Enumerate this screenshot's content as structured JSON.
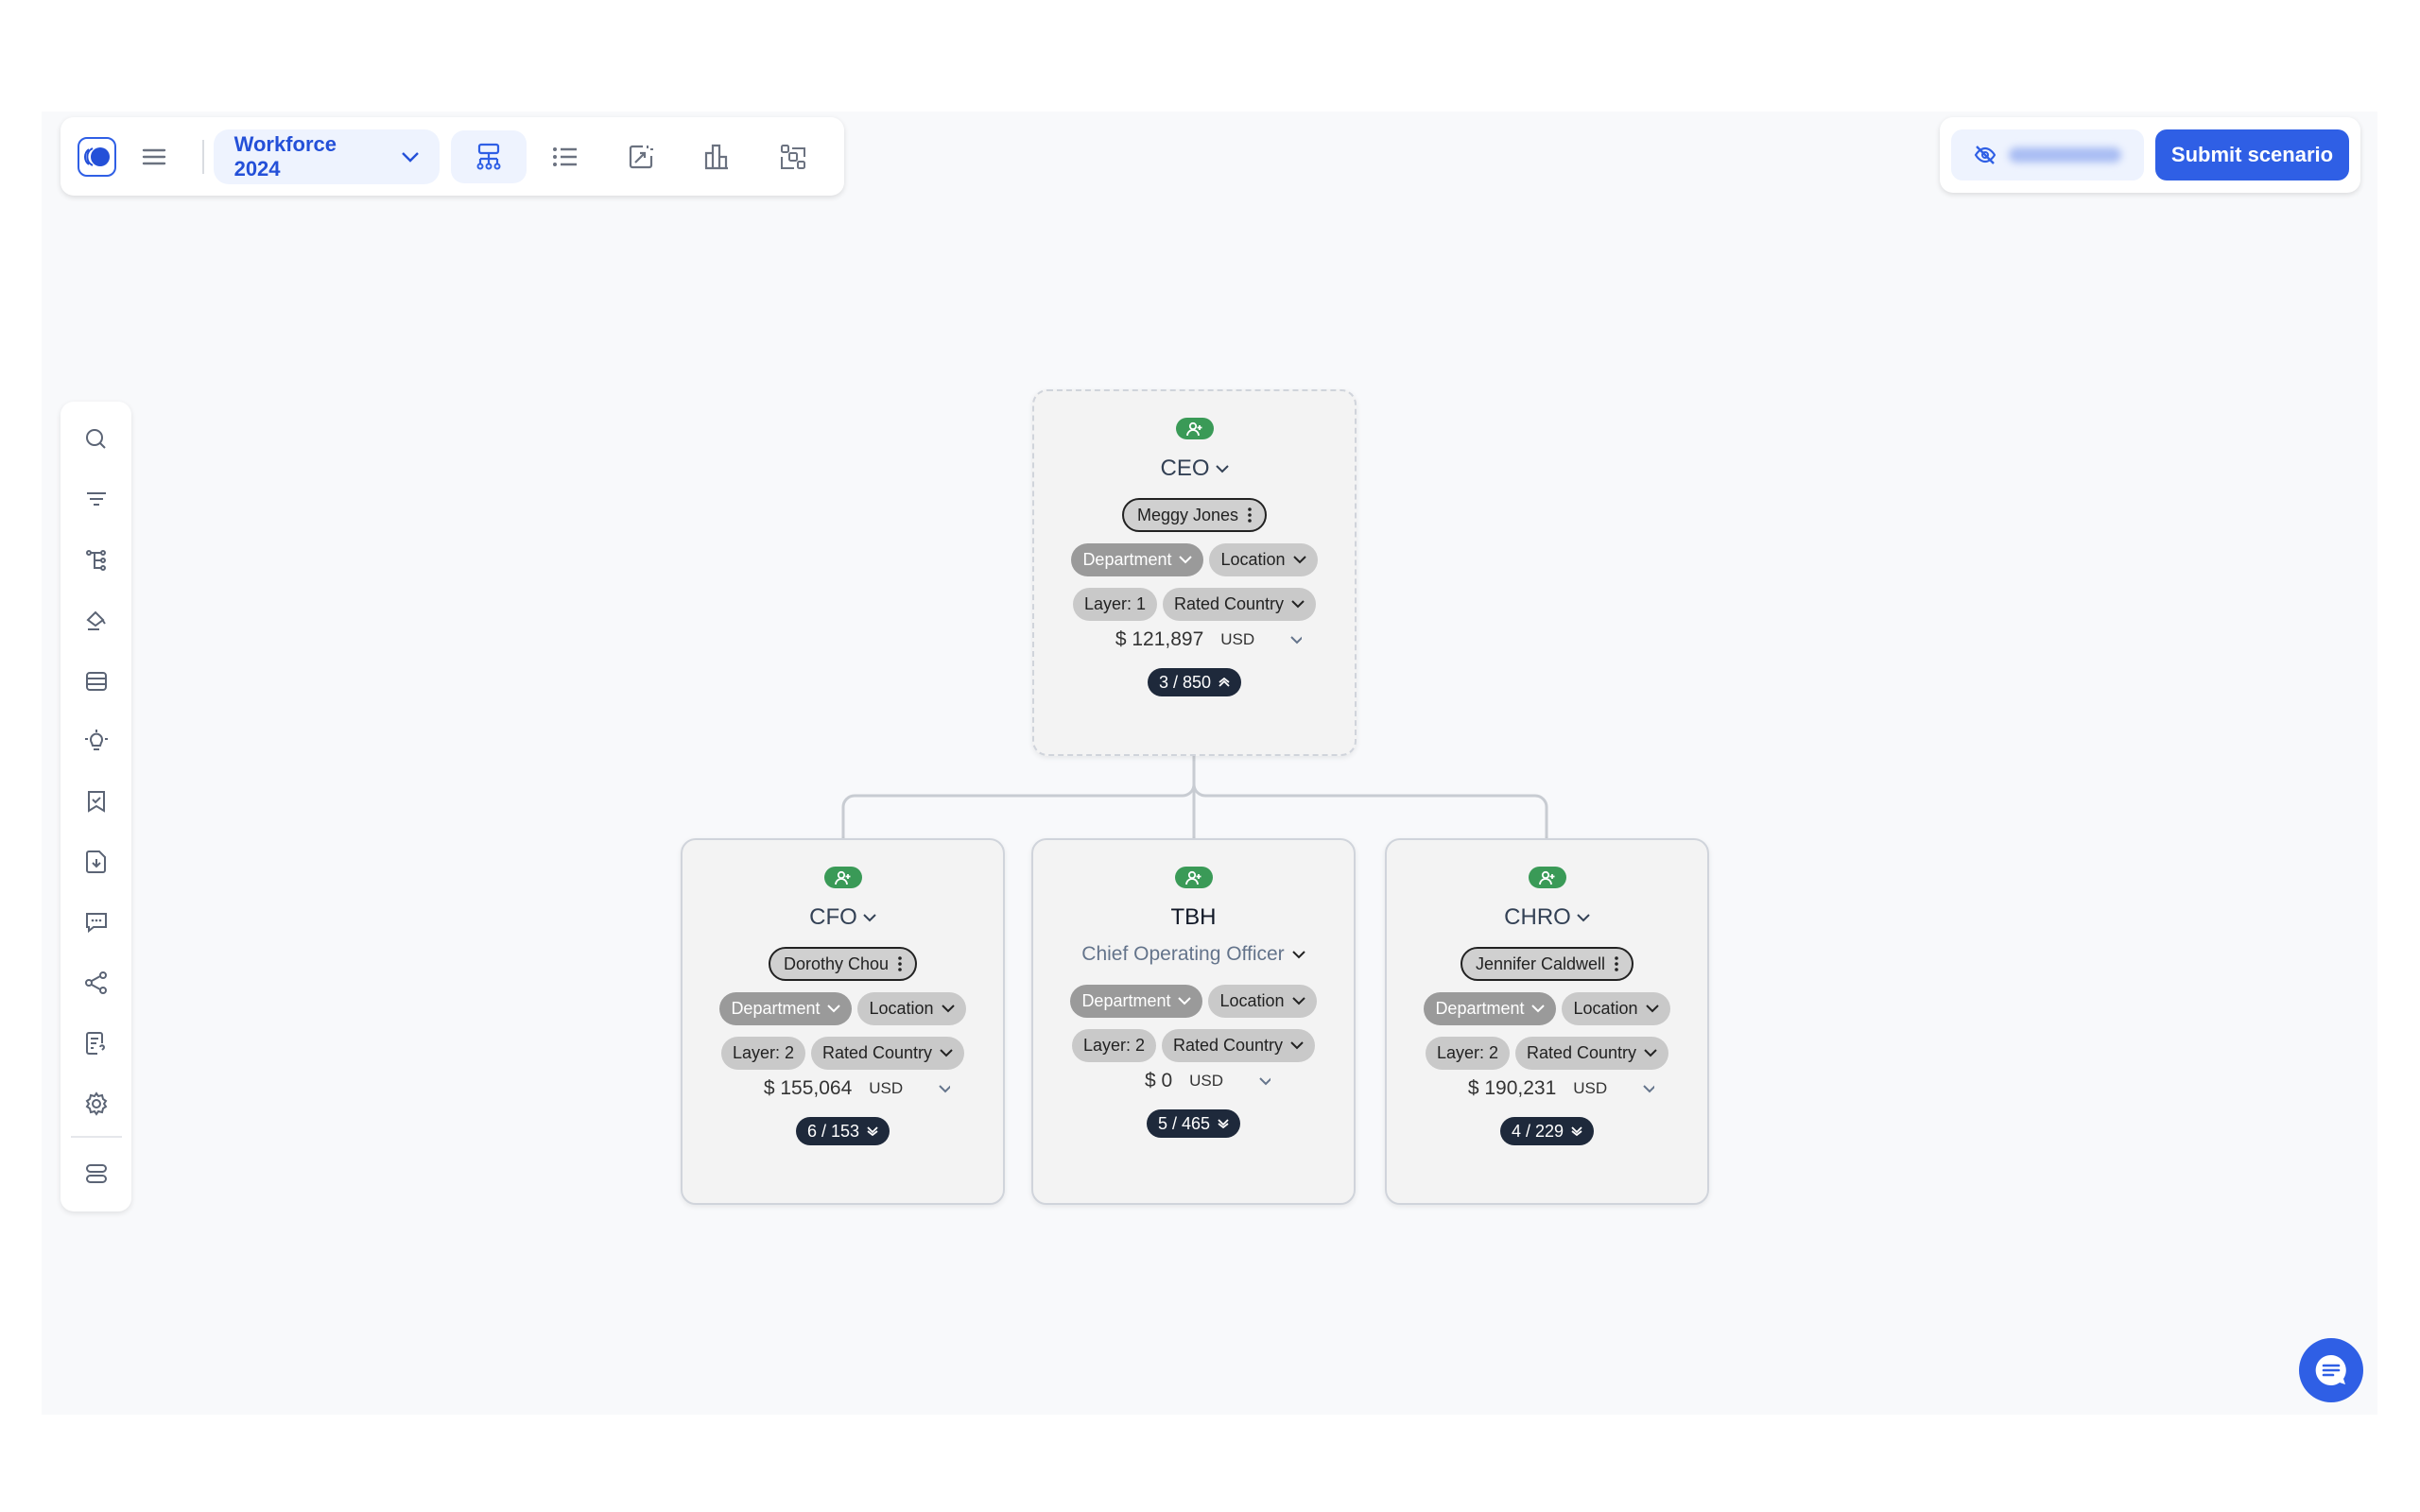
{
  "toolbar": {
    "scenario": "Workforce 2024",
    "icons": [
      "app-logo",
      "menu-icon",
      "org-chart-icon",
      "list-icon",
      "export-chart-icon",
      "bar-chart-icon",
      "compare-icon"
    ]
  },
  "actions": {
    "visibility_icon": "eye-off-icon",
    "submit_label": "Submit scenario"
  },
  "sidebar": {
    "items": [
      "search-icon",
      "filter-icon",
      "hierarchy-icon",
      "paint-bucket-icon",
      "table-icon",
      "lightbulb-icon",
      "bookmark-check-icon",
      "file-download-icon",
      "comment-icon",
      "share-icon",
      "file-question-icon",
      "settings-icon",
      "layers-icon"
    ]
  },
  "colors": {
    "accent": "#2f5fe5",
    "add_badge": "#3a9a57",
    "count_pill": "#1e293b"
  },
  "nodes": [
    {
      "title": "CEO",
      "name": "Meggy Jones",
      "department": "Department",
      "location": "Location",
      "layer": "Layer: 1",
      "rated_country": "Rated Country",
      "salary": "$ 121,897",
      "currency": "USD",
      "count": "3 / 850",
      "expanded": true
    },
    {
      "title": "CFO",
      "name": "Dorothy Chou",
      "department": "Department",
      "location": "Location",
      "layer": "Layer: 2",
      "rated_country": "Rated Country",
      "salary": "$ 155,064",
      "currency": "USD",
      "count": "6 / 153",
      "expanded": false
    },
    {
      "title": "TBH",
      "subtitle": "Chief Operating Officer",
      "department": "Department",
      "location": "Location",
      "layer": "Layer: 2",
      "rated_country": "Rated Country",
      "salary": "$ 0",
      "currency": "USD",
      "count": "5 / 465",
      "expanded": false
    },
    {
      "title": "CHRO",
      "name": "Jennifer Caldwell",
      "department": "Department",
      "location": "Location",
      "layer": "Layer: 2",
      "rated_country": "Rated Country",
      "salary": "$ 190,231",
      "currency": "USD",
      "count": "4 / 229",
      "expanded": false
    }
  ]
}
